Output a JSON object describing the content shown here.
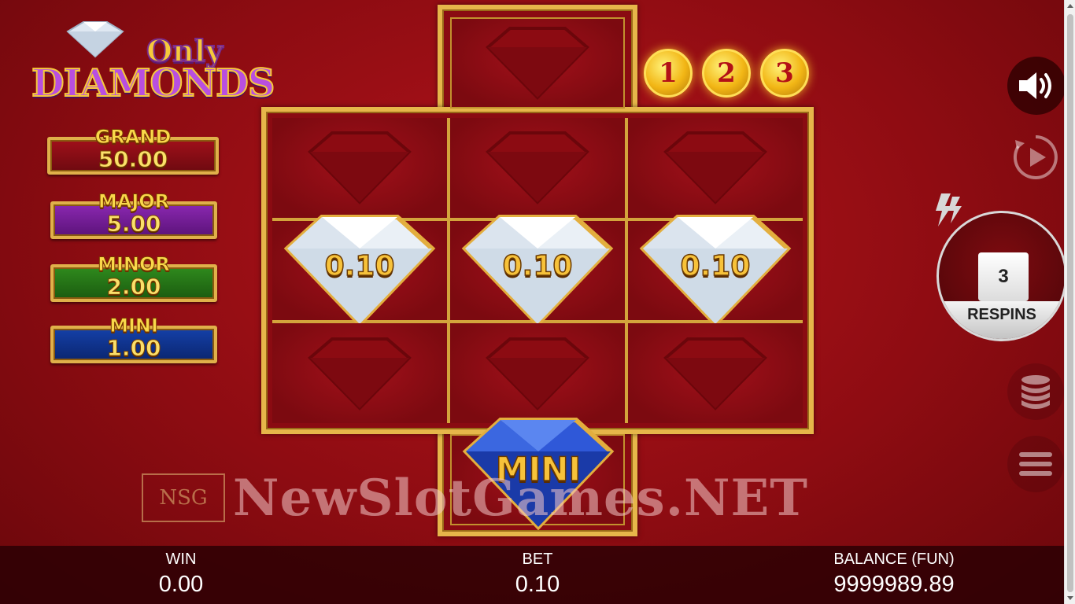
{
  "logo": {
    "line1": "Only",
    "line2": "DIAMONDS"
  },
  "jackpots": {
    "grand": {
      "label": "GRAND",
      "value": "50.00"
    },
    "major": {
      "label": "MAJOR",
      "value": "5.00"
    },
    "minor": {
      "label": "MINOR",
      "value": "2.00"
    },
    "mini": {
      "label": "MINI",
      "value": "1.00"
    }
  },
  "coins": [
    "1",
    "2",
    "3"
  ],
  "grid": {
    "row2": [
      "0.10",
      "0.10",
      "0.10"
    ],
    "bottom_symbol": "MINI"
  },
  "respins": {
    "count": "3",
    "label": "RESPINS"
  },
  "watermark": {
    "logo": "NSG",
    "text": "NewSlotGames.NET"
  },
  "bottom_bar": {
    "win": {
      "label": "WIN",
      "value": "0.00"
    },
    "bet": {
      "label": "BET",
      "value": "0.10"
    },
    "balance": {
      "label": "BALANCE (FUN)",
      "value": "9999989.89"
    }
  },
  "icons": {
    "sound": "speaker-icon",
    "autoplay": "autoplay-icon",
    "bets": "coin-stack-icon",
    "menu": "hamburger-menu-icon",
    "turbo": "lightning-icon"
  },
  "colors": {
    "background": "#9e0f16",
    "gold": "#e6b64a",
    "coin": "#f2b615"
  }
}
